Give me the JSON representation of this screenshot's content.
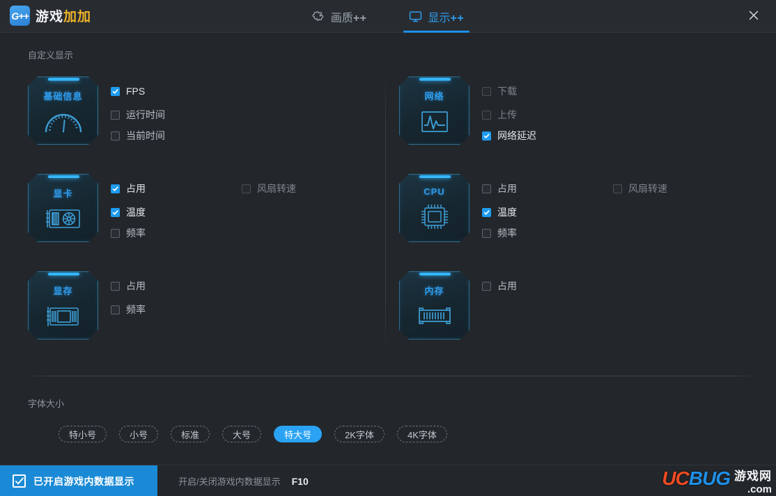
{
  "colors": {
    "accent": "#1e9bf0",
    "tab_active": "#2f9ced",
    "card_border": "#2b6f92",
    "card_title": "#2f9ced",
    "toggle_bar": "#1a8ad6",
    "chip_selected": "#2aa3f5",
    "titlebar_bg": "#282c31",
    "content_bg": "#23272b"
  },
  "titlebar": {
    "logo_mark": "G++",
    "logo_text_white": "游戏",
    "logo_text_yellow": "加加",
    "close_icon": "close-icon",
    "tabs": [
      {
        "label_cn": "画质",
        "label_pp": "++",
        "icon": "puzzle-icon",
        "active": false
      },
      {
        "label_cn": "显示",
        "label_pp": "++",
        "icon": "monitor-icon",
        "active": true
      }
    ]
  },
  "main": {
    "custom_display_label": "自定义显示",
    "font_size_label": "字体大小",
    "groups_left": [
      {
        "title": "基础信息",
        "icon": "speedometer-icon",
        "options": [
          {
            "label": "FPS",
            "checked": true,
            "col": 0,
            "row": 0,
            "disabled": false
          },
          {
            "label": "运行时间",
            "checked": false,
            "col": 0,
            "row": 1,
            "disabled": false
          },
          {
            "label": "当前时间",
            "checked": false,
            "col": 0,
            "row": 2,
            "disabled": false
          }
        ]
      },
      {
        "title": "显卡",
        "icon": "gpu-card-icon",
        "options": [
          {
            "label": "占用",
            "checked": true,
            "col": 0,
            "row": 0,
            "disabled": false
          },
          {
            "label": "温度",
            "checked": true,
            "col": 0,
            "row": 1,
            "disabled": false
          },
          {
            "label": "频率",
            "checked": false,
            "col": 0,
            "row": 2,
            "disabled": false
          },
          {
            "label": "风扇转速",
            "checked": false,
            "col": 1,
            "row": 0,
            "disabled": true
          }
        ]
      },
      {
        "title": "显存",
        "icon": "vram-card-icon",
        "options": [
          {
            "label": "占用",
            "checked": false,
            "col": 0,
            "row": 0,
            "disabled": false
          },
          {
            "label": "频率",
            "checked": false,
            "col": 0,
            "row": 1,
            "disabled": false
          }
        ]
      }
    ],
    "groups_right": [
      {
        "title": "网络",
        "icon": "network-graph-icon",
        "options": [
          {
            "label": "下载",
            "checked": false,
            "col": 0,
            "row": 0,
            "disabled": true
          },
          {
            "label": "上传",
            "checked": false,
            "col": 0,
            "row": 1,
            "disabled": true
          },
          {
            "label": "网络延迟",
            "checked": true,
            "col": 0,
            "row": 2,
            "disabled": false
          }
        ]
      },
      {
        "title": "CPU",
        "icon": "cpu-chip-icon",
        "options": [
          {
            "label": "占用",
            "checked": false,
            "col": 0,
            "row": 0,
            "disabled": false
          },
          {
            "label": "温度",
            "checked": true,
            "col": 0,
            "row": 1,
            "disabled": false
          },
          {
            "label": "频率",
            "checked": false,
            "col": 0,
            "row": 2,
            "disabled": false
          },
          {
            "label": "风扇转速",
            "checked": false,
            "col": 1,
            "row": 0,
            "disabled": true
          }
        ]
      },
      {
        "title": "内存",
        "icon": "ram-stick-icon",
        "options": [
          {
            "label": "占用",
            "checked": false,
            "col": 0,
            "row": 0,
            "disabled": false
          }
        ]
      }
    ],
    "font_sizes": [
      {
        "label": "特小号",
        "selected": false
      },
      {
        "label": "小号",
        "selected": false
      },
      {
        "label": "标准",
        "selected": false
      },
      {
        "label": "大号",
        "selected": false
      },
      {
        "label": "特大号",
        "selected": true
      },
      {
        "label": "2K字体",
        "selected": false
      },
      {
        "label": "4K字体",
        "selected": false
      }
    ]
  },
  "bottombar": {
    "toggle_label": "已开启游戏内数据显示",
    "toggle_checked": true,
    "hint_text": "开启/关闭游戏内数据显示",
    "hint_key": "F10",
    "watermark": {
      "uc": "UC",
      "bug": "BUG",
      "cn": "游戏网",
      "dot": ".com"
    }
  }
}
